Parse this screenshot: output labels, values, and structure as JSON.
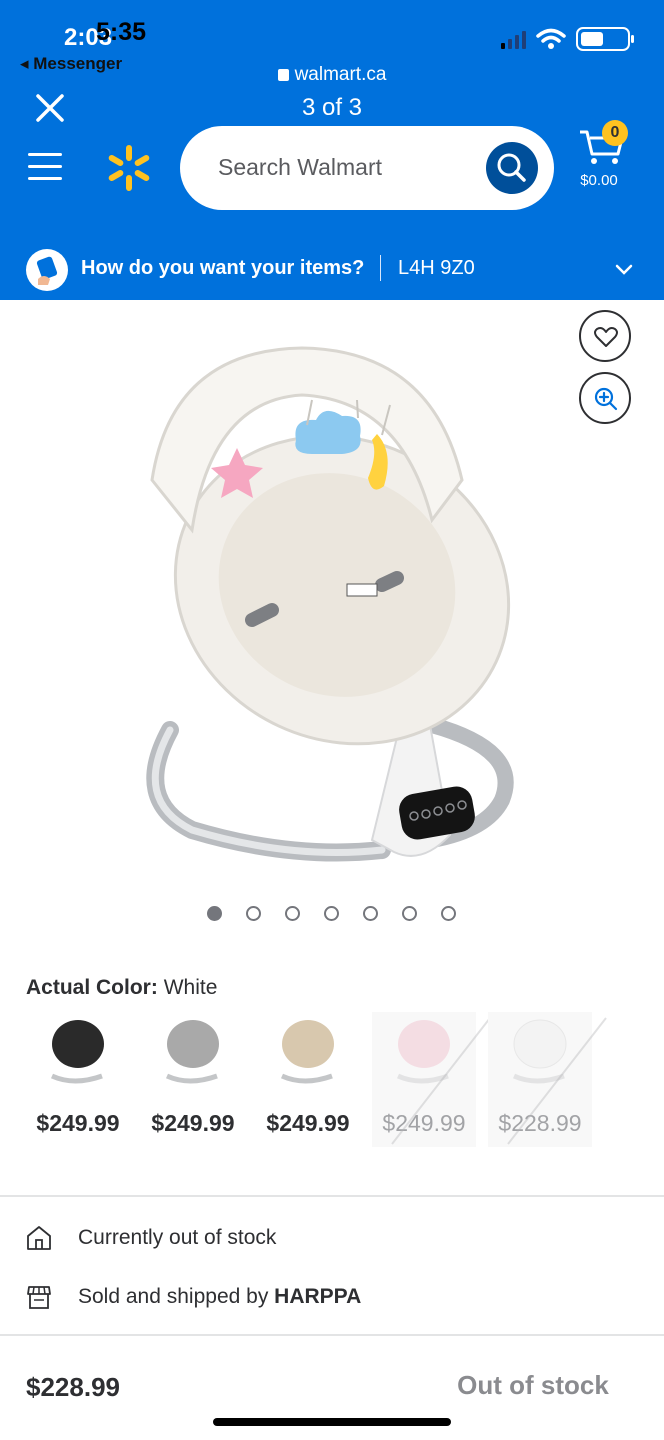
{
  "status_bar": {
    "time_back": "2:03",
    "time_front": "5:35",
    "back_app": "◂ Messenger"
  },
  "browser": {
    "url": "walmart.ca",
    "page_count": "3 of 3"
  },
  "header": {
    "search_placeholder": "Search Walmart",
    "cart_count": "0",
    "cart_total": "$0.00"
  },
  "delivery": {
    "question": "How do you want your items?",
    "postal_code": "L4H 9Z0"
  },
  "gallery": {
    "dots": [
      true,
      false,
      false,
      false,
      false,
      false,
      false
    ]
  },
  "product": {
    "color_label": "Actual Color:",
    "color_value": "White",
    "variants": [
      {
        "color": "#2a2a2a",
        "price": "$249.99",
        "available": true
      },
      {
        "color": "#a9a9a9",
        "price": "$249.99",
        "available": true
      },
      {
        "color": "#d8c8ae",
        "price": "$249.99",
        "available": true
      },
      {
        "color": "#f0b6c6",
        "price": "$249.99",
        "available": false
      },
      {
        "color": "#ececec",
        "price": "$228.99",
        "available": false
      }
    ],
    "stock_status": "Currently out of stock",
    "sold_by_prefix": "Sold and shipped by",
    "seller": "HARPPA",
    "price": "$228.99",
    "action_label": "Out of stock"
  },
  "colors": {
    "brand_blue": "#0071dc",
    "spark_yellow": "#ffc220",
    "search_button": "#004f9a"
  }
}
